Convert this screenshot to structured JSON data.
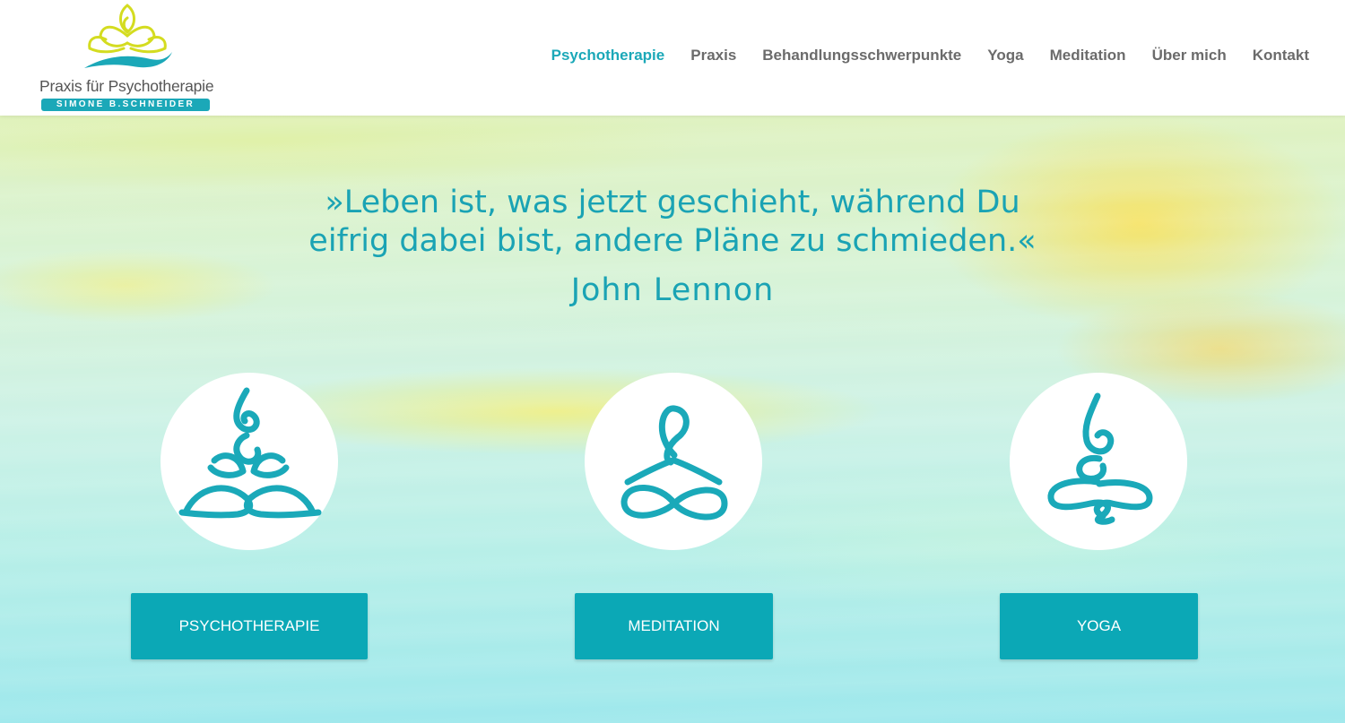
{
  "logo": {
    "title": "Praxis für Psychotherapie",
    "subtitle": "SIMONE B.SCHNEIDER",
    "icon": "lotus-logo-icon"
  },
  "nav": {
    "items": [
      {
        "label": "Psychotherapie",
        "active": true
      },
      {
        "label": "Praxis",
        "active": false
      },
      {
        "label": "Behandlungsschwerpunkte",
        "active": false
      },
      {
        "label": "Yoga",
        "active": false
      },
      {
        "label": "Meditation",
        "active": false
      },
      {
        "label": "Über mich",
        "active": false
      },
      {
        "label": "Kontakt",
        "active": false
      }
    ]
  },
  "hero": {
    "quote_line1": "»Leben ist, was jetzt geschieht, während Du",
    "quote_line2": "eifrig dabei bist, andere Pläne zu schmieden.«",
    "author": "John Lennon"
  },
  "features": [
    {
      "icon": "lotus-figure-icon",
      "button_label": "PSYCHOTHERAPIE"
    },
    {
      "icon": "meditation-figure-icon",
      "button_label": "MEDITATION"
    },
    {
      "icon": "yoga-figure-icon",
      "button_label": "YOGA"
    }
  ],
  "colors": {
    "accent": "#1ba8b8",
    "nav_text": "#6b6b6b",
    "button_bg": "#0ba8b6",
    "logo_yellow": "#d4dc20"
  }
}
